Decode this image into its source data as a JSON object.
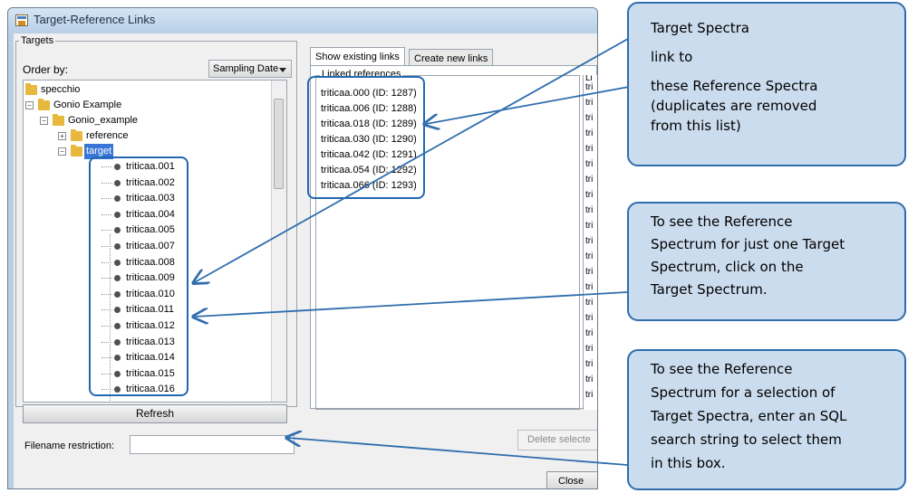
{
  "window": {
    "title": "Target-Reference Links"
  },
  "targets": {
    "group_label": "Targets",
    "order_label": "Order by:",
    "order_value": "Sampling Date",
    "tree": {
      "root": "specchio",
      "campaign": "Gonio Example",
      "folder": "Gonio_example",
      "subfolder_reference": "reference",
      "subfolder_target": "target",
      "items": [
        "triticaa.001",
        "triticaa.002",
        "triticaa.003",
        "triticaa.004",
        "triticaa.005",
        "triticaa.007",
        "triticaa.008",
        "triticaa.009",
        "triticaa.010",
        "triticaa.011",
        "triticaa.012",
        "triticaa.013",
        "triticaa.014",
        "triticaa.015",
        "triticaa.016"
      ]
    },
    "refresh_label": "Refresh",
    "filename_label": "Filename restriction:",
    "filename_value": ""
  },
  "tabs": {
    "existing": "Show existing links",
    "create": "Create new links"
  },
  "linked": {
    "caption": "Linked references",
    "items": [
      "triticaa.000 (ID: 1287)",
      "triticaa.006 (ID: 1288)",
      "triticaa.018 (ID: 1289)",
      "triticaa.030 (ID: 1290)",
      "triticaa.042 (ID: 1291)",
      "triticaa.054 (ID: 1292)",
      "triticaa.066 (ID: 1293)"
    ],
    "second_caption_fragment": "Li",
    "second_item_fragment": "tri"
  },
  "buttons": {
    "delete": "Delete selecte",
    "close": "Close"
  },
  "callouts": {
    "c1": {
      "l1": "Target Spectra",
      "l2": "link to",
      "l3": "these Reference Spectra",
      "l4": "(duplicates are removed",
      "l5": "from this list)"
    },
    "c2": {
      "l1": "To see the Reference",
      "l2": "Spectrum for just one Target",
      "l3": "Spectrum, click on the",
      "l4": "Target Spectrum."
    },
    "c3": {
      "l1": "To see the Reference",
      "l2": "Spectrum for a selection of",
      "l3": "Target Spectra, enter an SQL",
      "l4": "search string to select them",
      "l5": "in this box."
    }
  },
  "colors": {
    "callout_fill": "#cbdcee",
    "callout_border": "#2f6dad",
    "selection": "#3a76d8"
  }
}
